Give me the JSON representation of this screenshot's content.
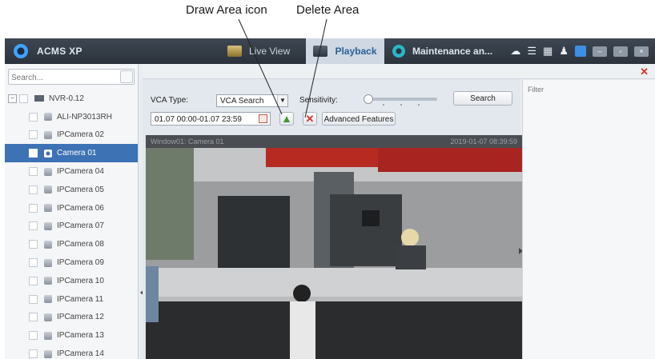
{
  "annotations": {
    "draw_area": "Draw Area icon",
    "delete_area": "Delete Area"
  },
  "app": {
    "title": "ACMS XP",
    "tabs": {
      "live": "Live View",
      "playback": "Playback",
      "maintenance": "Maintenance an..."
    }
  },
  "sidebar": {
    "search_placeholder": "Search...",
    "tree": [
      {
        "label": "NVR-0.12",
        "type": "root"
      },
      {
        "label": "ALI-NP3013RH",
        "type": "camera"
      },
      {
        "label": "IPCamera 02",
        "type": "camera"
      },
      {
        "label": "Camera 01",
        "type": "camera",
        "selected": true
      },
      {
        "label": "IPCamera 04",
        "type": "camera"
      },
      {
        "label": "IPCamera 05",
        "type": "camera"
      },
      {
        "label": "IPCamera 06",
        "type": "camera"
      },
      {
        "label": "IPCamera 07",
        "type": "camera"
      },
      {
        "label": "IPCamera 08",
        "type": "camera"
      },
      {
        "label": "IPCamera 09",
        "type": "camera"
      },
      {
        "label": "IPCamera 10",
        "type": "camera"
      },
      {
        "label": "IPCamera 11",
        "type": "camera"
      },
      {
        "label": "IPCamera 12",
        "type": "camera"
      },
      {
        "label": "IPCamera 13",
        "type": "camera"
      },
      {
        "label": "IPCamera 14",
        "type": "camera"
      }
    ]
  },
  "controls": {
    "vca_type_label": "VCA Type:",
    "vca_type_value": "VCA Search",
    "sensitivity_label": "Sensitivity:",
    "sensitivity_level": 0,
    "search_button": "Search",
    "time_range": "01.07 00:00-01.07 23:59",
    "advanced_button": "Advanced Features"
  },
  "video": {
    "window_title": "Window01: Camera 01",
    "timestamp": "2019-01-07 08:39:59"
  },
  "filter": {
    "placeholder": "Filter"
  },
  "colors": {
    "titlebar": "#2b323b",
    "selected_row": "#3d72b4",
    "accent": "#2a5f9a",
    "delete_red": "#d8342a",
    "draw_green": "#3f9a2a"
  }
}
